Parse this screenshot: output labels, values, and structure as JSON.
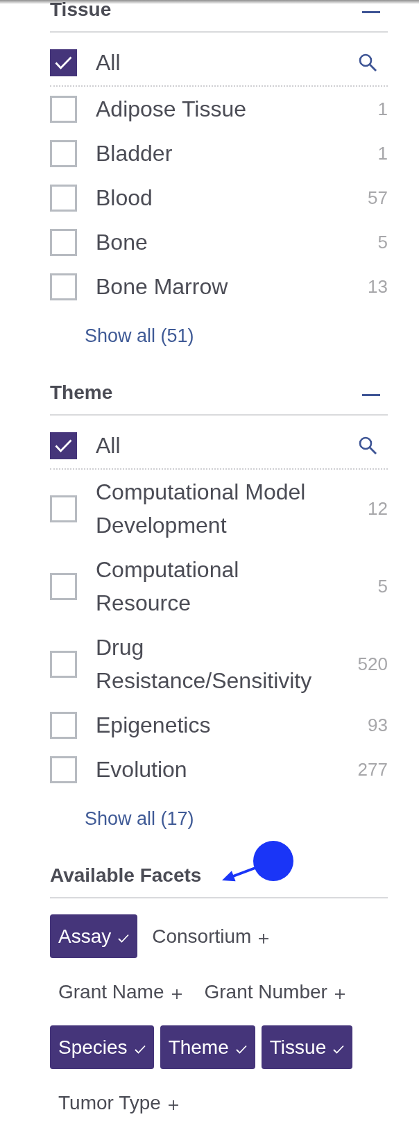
{
  "facet_groups": [
    {
      "title": "Tissue",
      "expanded": true,
      "all_option": {
        "label": "All",
        "checked": true
      },
      "options": [
        {
          "label": "Adipose Tissue",
          "count": "1",
          "checked": false
        },
        {
          "label": "Bladder",
          "count": "1",
          "checked": false
        },
        {
          "label": "Blood",
          "count": "57",
          "checked": false
        },
        {
          "label": "Bone",
          "count": "5",
          "checked": false
        },
        {
          "label": "Bone Marrow",
          "count": "13",
          "checked": false
        }
      ],
      "show_all": "Show all (51)"
    },
    {
      "title": "Theme",
      "expanded": true,
      "all_option": {
        "label": "All",
        "checked": true
      },
      "options": [
        {
          "label": "Computational Model Development",
          "count": "12",
          "checked": false
        },
        {
          "label": "Computational Resource",
          "count": "5",
          "checked": false
        },
        {
          "label": "Drug Resistance/Sensitivity",
          "count": "520",
          "checked": false
        },
        {
          "label": "Epigenetics",
          "count": "93",
          "checked": false
        },
        {
          "label": "Evolution",
          "count": "277",
          "checked": false
        }
      ],
      "show_all": "Show all (17)"
    }
  ],
  "available_facets": {
    "title": "Available Facets",
    "facets": [
      {
        "label": "Assay",
        "selected": true
      },
      {
        "label": "Consortium",
        "selected": false
      },
      {
        "label": "Grant Name",
        "selected": false
      },
      {
        "label": "Grant Number",
        "selected": false
      },
      {
        "label": "Species",
        "selected": true
      },
      {
        "label": "Theme",
        "selected": true
      },
      {
        "label": "Tissue",
        "selected": true
      },
      {
        "label": "Tumor Type",
        "selected": false
      }
    ]
  }
}
